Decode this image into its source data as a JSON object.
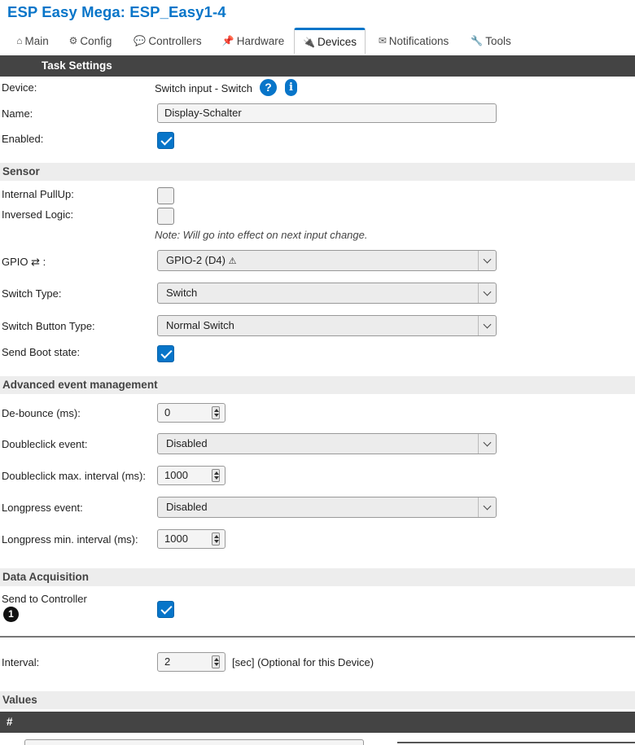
{
  "app": {
    "title": "ESP Easy Mega: ESP_Easy1-4"
  },
  "tabs": [
    {
      "label": "Main",
      "icon": "house-icon",
      "glyph": "⌂"
    },
    {
      "label": "Config",
      "icon": "gear-icon",
      "glyph": "⚙"
    },
    {
      "label": "Controllers",
      "icon": "chat-icon",
      "glyph": "💬"
    },
    {
      "label": "Hardware",
      "icon": "pin-icon",
      "glyph": "📌"
    },
    {
      "label": "Devices",
      "icon": "plug-icon",
      "glyph": "🔌"
    },
    {
      "label": "Notifications",
      "icon": "envelope-icon",
      "glyph": "✉"
    },
    {
      "label": "Tools",
      "icon": "wrench-icon",
      "glyph": "🔧"
    }
  ],
  "active_tab": "Devices",
  "task_settings": {
    "header": "Task Settings",
    "device_label": "Device:",
    "device_value": "Switch input - Switch",
    "help_glyph": "?",
    "info_glyph": "i",
    "name_label": "Name:",
    "name_value": "Display-Schalter",
    "enabled_label": "Enabled:",
    "enabled": true
  },
  "sensor": {
    "header": "Sensor",
    "pullup_label": "Internal PullUp:",
    "pullup": false,
    "inversed_label": "Inversed Logic:",
    "inversed": false,
    "note": "Note: Will go into effect on next input change.",
    "gpio_label": "GPIO ⇄ :",
    "gpio_value": "GPIO-2 (D4)",
    "gpio_warning": "⚠",
    "switch_type_label": "Switch Type:",
    "switch_type_value": "Switch",
    "button_type_label": "Switch Button Type:",
    "button_type_value": "Normal Switch",
    "boot_state_label": "Send Boot state:",
    "boot_state": true
  },
  "advanced": {
    "header": "Advanced event management",
    "debounce_label": "De-bounce (ms):",
    "debounce_value": "0",
    "doubleclick_label": "Doubleclick event:",
    "doubleclick_value": "Disabled",
    "dc_interval_label": "Doubleclick max. interval (ms):",
    "dc_interval_value": "1000",
    "longpress_label": "Longpress event:",
    "longpress_value": "Disabled",
    "lp_interval_label": "Longpress min. interval (ms):",
    "lp_interval_value": "1000"
  },
  "data_acquisition": {
    "header": "Data Acquisition",
    "send_label": "Send to Controller",
    "controller_number": "1",
    "send": true,
    "interval_label": "Interval:",
    "interval_value": "2",
    "interval_suffix": "[sec] (Optional for this Device)"
  },
  "values": {
    "header": "Values",
    "col_hash": "#"
  },
  "colors": {
    "accent": "#0775c9",
    "header_bar": "#444444",
    "section_bg": "#ededed"
  }
}
